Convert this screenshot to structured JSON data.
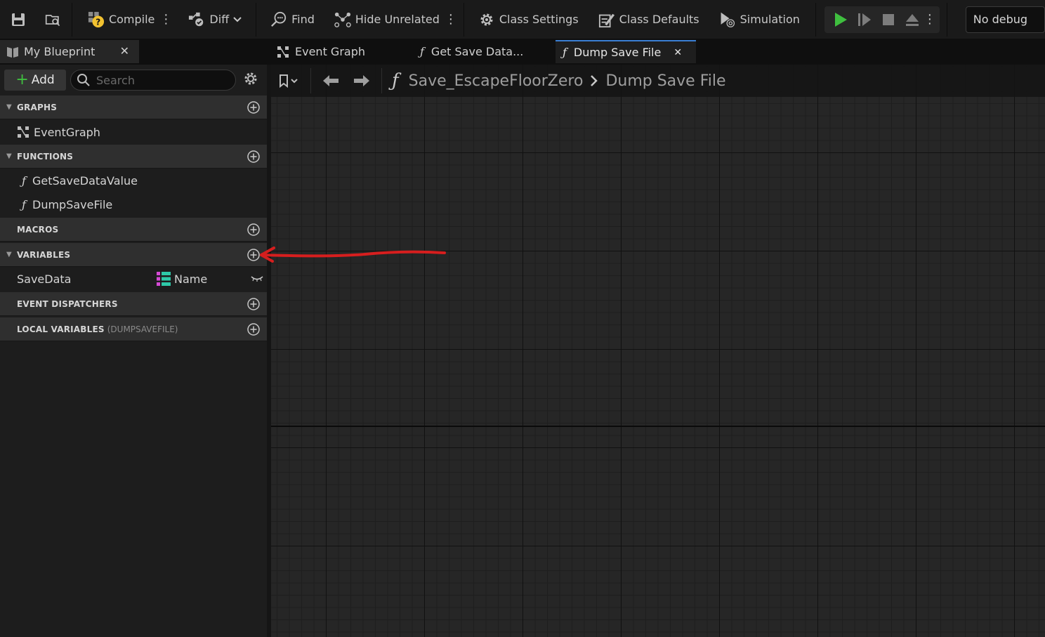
{
  "toolbar": {
    "compile_label": "Compile",
    "diff_label": "Diff",
    "find_label": "Find",
    "hide_unrelated_label": "Hide Unrelated",
    "class_settings_label": "Class Settings",
    "class_defaults_label": "Class Defaults",
    "simulation_label": "Simulation",
    "debug_filter_value": "No debug"
  },
  "tabs": {
    "panel_tab_label": "My Blueprint",
    "doc_tabs": [
      {
        "label": "Event Graph",
        "icon": "event-graph-icon"
      },
      {
        "label": "Get Save Data...",
        "icon": "function-icon"
      },
      {
        "label": "Dump Save File",
        "icon": "function-icon",
        "active": true
      }
    ]
  },
  "my_blueprint": {
    "add_label": "Add",
    "search_placeholder": "Search",
    "sections": {
      "graphs": {
        "title": "GRAPHS",
        "items": [
          "EventGraph"
        ]
      },
      "functions": {
        "title": "FUNCTIONS",
        "items": [
          "GetSaveDataValue",
          "DumpSaveFile"
        ]
      },
      "macros": {
        "title": "MACROS"
      },
      "variables": {
        "title": "VARIABLES",
        "items": [
          {
            "name": "SaveData",
            "type": "Name"
          }
        ]
      },
      "event_dispatchers": {
        "title": "EVENT DISPATCHERS"
      },
      "local_variables": {
        "title": "LOCAL VARIABLES",
        "context": "(DUMPSAVEFILE)"
      }
    }
  },
  "graph": {
    "breadcrumb_parent": "Save_EscapeFloorZero",
    "breadcrumb_current": "Dump Save File"
  },
  "colors": {
    "accent_blue": "#3a7fd4",
    "play_green": "#3fbf3f",
    "annotation_red": "#d61e1e",
    "variable_type_cyan": "#2ec9a8",
    "variable_type_magenta": "#d54ad5"
  }
}
